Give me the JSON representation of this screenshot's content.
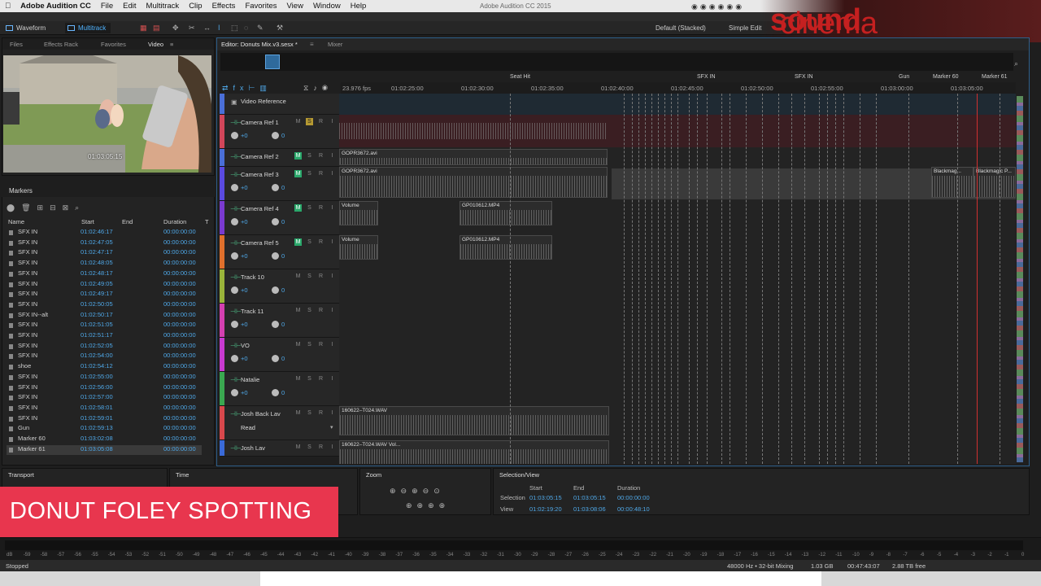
{
  "menubar": {
    "app": "Adobe Audition CC",
    "items": [
      "File",
      "Edit",
      "Multitrack",
      "Clip",
      "Effects",
      "Favorites",
      "View",
      "Window",
      "Help"
    ],
    "window_title": "Adobe Audition CC 2015"
  },
  "toolbar": {
    "waveform_label": "Waveform",
    "multitrack_label": "Multitrack",
    "workspace": "Default (Stacked)",
    "workspace2": "Simple Edit"
  },
  "logo": {
    "part1": "cinema",
    "part2": "sound"
  },
  "left_tabs": [
    "Files",
    "Effects Rack",
    "Favorites",
    "Video"
  ],
  "video": {
    "timecode": "01:03:05:15"
  },
  "markers": {
    "title": "Markers",
    "columns": [
      "Name",
      "Start",
      "End",
      "Duration",
      "T"
    ],
    "rows": [
      {
        "name": "SFX IN",
        "start": "01:02:46:17",
        "duration": "00:00:00:00"
      },
      {
        "name": "SFX IN",
        "start": "01:02:47:05",
        "duration": "00:00:00:00"
      },
      {
        "name": "SFX IN",
        "start": "01:02:47:17",
        "duration": "00:00:00:00"
      },
      {
        "name": "SFX IN",
        "start": "01:02:48:05",
        "duration": "00:00:00:00"
      },
      {
        "name": "SFX IN",
        "start": "01:02:48:17",
        "duration": "00:00:00:00"
      },
      {
        "name": "SFX IN",
        "start": "01:02:49:05",
        "duration": "00:00:00:00"
      },
      {
        "name": "SFX IN",
        "start": "01:02:49:17",
        "duration": "00:00:00:00"
      },
      {
        "name": "SFX IN",
        "start": "01:02:50:05",
        "duration": "00:00:00:00"
      },
      {
        "name": "SFX IN--alt",
        "start": "01:02:50:17",
        "duration": "00:00:00:00"
      },
      {
        "name": "SFX IN",
        "start": "01:02:51:05",
        "duration": "00:00:00:00"
      },
      {
        "name": "SFX IN",
        "start": "01:02:51:17",
        "duration": "00:00:00:00"
      },
      {
        "name": "SFX IN",
        "start": "01:02:52:05",
        "duration": "00:00:00:00"
      },
      {
        "name": "SFX IN",
        "start": "01:02:54:00",
        "duration": "00:00:00:00"
      },
      {
        "name": "shoe",
        "start": "01:02:54:12",
        "duration": "00:00:00:00"
      },
      {
        "name": "SFX IN",
        "start": "01:02:55:00",
        "duration": "00:00:00:00"
      },
      {
        "name": "SFX IN",
        "start": "01:02:56:00",
        "duration": "00:00:00:00"
      },
      {
        "name": "SFX IN",
        "start": "01:02:57:00",
        "duration": "00:00:00:00"
      },
      {
        "name": "SFX IN",
        "start": "01:02:58:01",
        "duration": "00:00:00:00"
      },
      {
        "name": "SFX IN",
        "start": "01:02:59:01",
        "duration": "00:00:00:00"
      },
      {
        "name": "Gun",
        "start": "01:02:59:13",
        "duration": "00:00:00:00"
      },
      {
        "name": "Marker 60",
        "start": "01:03:02:08",
        "duration": "00:00:00:00"
      },
      {
        "name": "Marker 61",
        "start": "01:03:05:08",
        "duration": "00:00:00:00"
      }
    ]
  },
  "editor": {
    "tab": "Editor: Donuts Mix.v3.sesx *",
    "tab2": "Mixer",
    "fps": "23.976 fps",
    "ruler": [
      "01:02:25:00",
      "01:02:30:00",
      "01:02:35:00",
      "01:02:40:00",
      "01:02:45:00",
      "01:02:50:00",
      "01:02:55:00",
      "01:03:00:00",
      "01:03:05:00"
    ],
    "marker_labels": [
      "Seat Hit",
      "SFX IN",
      "SFX IN",
      "Gun",
      "Marker 60",
      "Marker 61"
    ],
    "video_track": "Video Reference",
    "tracks": [
      {
        "name": "Camera Ref 1",
        "vol": "+0",
        "pan": "0",
        "color": "#d2465a"
      },
      {
        "name": "Camera Ref 2",
        "vol": "+0",
        "pan": "0",
        "color": "#4a6fd8"
      },
      {
        "name": "Camera Ref 3",
        "vol": "+0",
        "pan": "0",
        "color": "#5a4ae0"
      },
      {
        "name": "Camera Ref 4",
        "vol": "+0",
        "pan": "0",
        "color": "#7a3ad0"
      },
      {
        "name": "Camera Ref 5",
        "vol": "+0",
        "pan": "0",
        "color": "#e0702c"
      },
      {
        "name": "Track 10",
        "vol": "+0",
        "pan": "0",
        "color": "#9ab43a"
      },
      {
        "name": "Track 11",
        "vol": "+0",
        "pan": "0",
        "color": "#d440b0"
      },
      {
        "name": "VO",
        "vol": "+0",
        "pan": "0",
        "color": "#c83ad0"
      },
      {
        "name": "Natalie",
        "vol": "+0",
        "pan": "0",
        "color": "#3aa850"
      },
      {
        "name": "Josh Back Lav",
        "vol": "Read",
        "pan": "",
        "color": "#d8484c"
      },
      {
        "name": "Josh Lav",
        "vol": "",
        "pan": "",
        "color": "#3a6ad8"
      }
    ],
    "clips": {
      "gopr": "GOPR3672.avi",
      "gp": "GP010612.MP4",
      "wav": "160622–T024.WAV",
      "wavvol": "160622–T024.WAV Vol...",
      "blackmagic": "Blackmag...",
      "blackmagic2": "Blackmagic P...",
      "volume": "Volume"
    }
  },
  "transport": {
    "title": "Transport"
  },
  "time": {
    "title": "Time"
  },
  "zoom": {
    "title": "Zoom"
  },
  "selection": {
    "title": "Selection/View",
    "cols": [
      "Start",
      "End",
      "Duration"
    ],
    "sel_label": "Selection",
    "view_label": "View",
    "sel_start": "01:03:05:15",
    "sel_end": "01:03:05:15",
    "sel_dur": "00:00:00:00",
    "view_start": "01:02:19:20",
    "view_end": "01:03:08:06",
    "view_dur": "00:00:48:10"
  },
  "banner": {
    "text": "DONUT FOLEY SPOTTING"
  },
  "meter_ticks": [
    "dB",
    "-59",
    "-58",
    "-57",
    "-56",
    "-55",
    "-54",
    "-53",
    "-52",
    "-51",
    "-50",
    "-49",
    "-48",
    "-47",
    "-46",
    "-45",
    "-44",
    "-43",
    "-42",
    "-41",
    "-40",
    "-39",
    "-38",
    "-37",
    "-36",
    "-35",
    "-34",
    "-33",
    "-32",
    "-31",
    "-30",
    "-29",
    "-28",
    "-27",
    "-26",
    "-25",
    "-24",
    "-23",
    "-22",
    "-21",
    "-20",
    "-19",
    "-18",
    "-17",
    "-16",
    "-15",
    "-14",
    "-13",
    "-12",
    "-11",
    "-10",
    "-9",
    "-8",
    "-7",
    "-6",
    "-5",
    "-4",
    "-3",
    "-2",
    "-1",
    "0"
  ],
  "status": {
    "state": "Stopped",
    "rate": "48000 Hz • 32-bit Mixing",
    "mem": "1.03 GB",
    "dur": "00:47:43:07",
    "free": "2.88 TB free"
  }
}
